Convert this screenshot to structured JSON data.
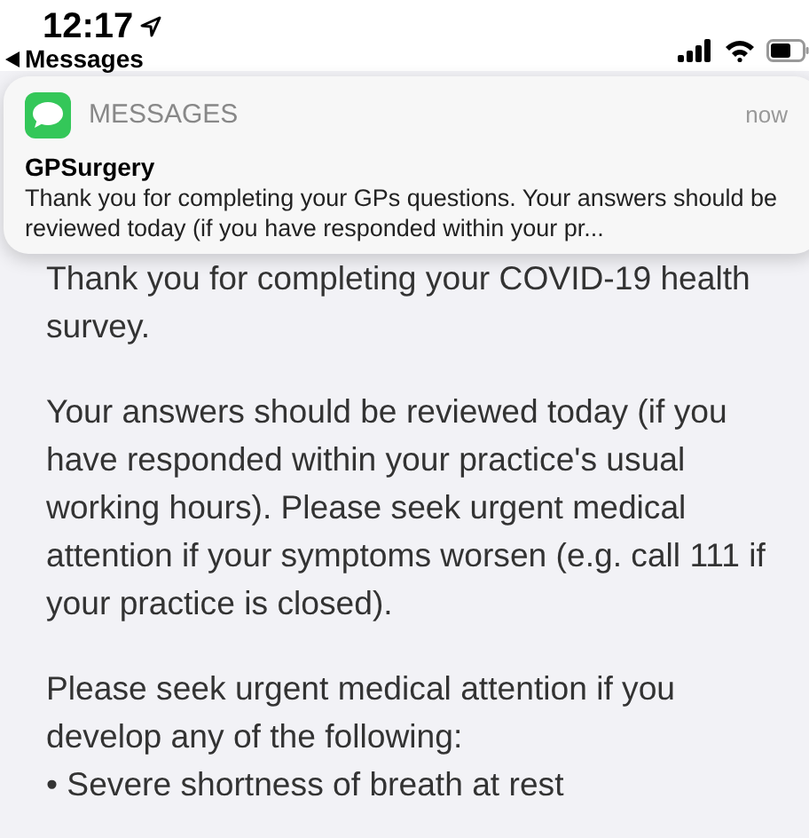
{
  "status_bar": {
    "time": "12:17",
    "back_link": "Messages"
  },
  "notification": {
    "app": "MESSAGES",
    "time": "now",
    "sender": "GPSurgery",
    "body": "Thank you for completing your GPs questions. Your answers should be reviewed today (if you have responded within your pr..."
  },
  "message": {
    "paragraphs": [
      "Thank you for completing your COVID-19 health survey.",
      "Your answers should be reviewed today (if you have responded within your practice's usual working hours). Please seek urgent medical attention if your symptoms worsen (e.g. call 111 if your practice is closed).",
      "Please seek urgent medical attention if you develop any of the following:"
    ],
    "bullets": [
      "• Severe shortness of breath at rest"
    ]
  }
}
